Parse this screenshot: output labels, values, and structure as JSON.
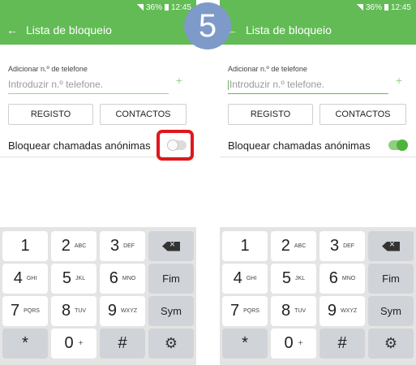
{
  "step_badge": "5",
  "status_bar": {
    "battery": "36%",
    "time": "12:45"
  },
  "app_bar": {
    "title": "Lista de bloqueio"
  },
  "add_number": {
    "label": "Adicionar n.º de telefone",
    "placeholder": "Introduzir n.º telefone."
  },
  "buttons": {
    "registo": "REGISTO",
    "contactos": "CONTACTOS"
  },
  "block_anonymous": {
    "label": "Bloquear chamadas anónimas",
    "left_state": "off",
    "right_state": "on"
  },
  "keyboard": {
    "rows": [
      [
        {
          "num": "1",
          "letters": ""
        },
        {
          "num": "2",
          "letters": "ABC"
        },
        {
          "num": "3",
          "letters": "DEF"
        },
        {
          "func": "backspace"
        }
      ],
      [
        {
          "num": "4",
          "letters": "GHI"
        },
        {
          "num": "5",
          "letters": "JKL"
        },
        {
          "num": "6",
          "letters": "MNO"
        },
        {
          "word": "Fim"
        }
      ],
      [
        {
          "num": "7",
          "letters": "PQRS"
        },
        {
          "num": "8",
          "letters": "TUV"
        },
        {
          "num": "9",
          "letters": "WXYZ"
        },
        {
          "word": "Sym"
        }
      ],
      [
        {
          "num": "*",
          "letters": ""
        },
        {
          "num": "0",
          "letters": "+"
        },
        {
          "num": "#",
          "letters": ""
        },
        {
          "func": "settings"
        }
      ]
    ]
  },
  "colors": {
    "accent": "#62bb55",
    "highlight": "#e0161c",
    "badge": "#7d9ac8"
  }
}
